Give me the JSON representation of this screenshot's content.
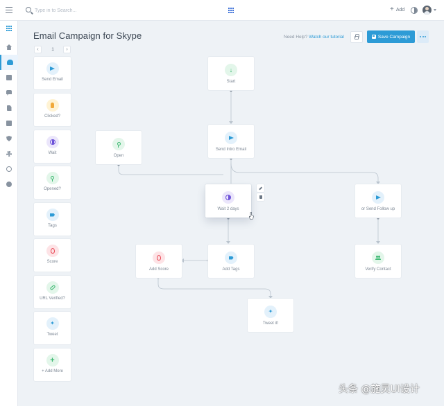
{
  "topbar": {
    "search_placeholder": "Type in to Search...",
    "apps_icon": "apps-grid-icon",
    "add_label": "Add"
  },
  "sidebar": {
    "items": [
      {
        "icon": "apps-icon"
      },
      {
        "icon": "home-icon"
      },
      {
        "icon": "users-icon",
        "active": true
      },
      {
        "icon": "building-icon"
      },
      {
        "icon": "chat-icon"
      },
      {
        "icon": "document-icon"
      },
      {
        "icon": "calendar-icon"
      },
      {
        "icon": "shield-icon"
      },
      {
        "icon": "gear-icon"
      },
      {
        "icon": "clock-icon"
      },
      {
        "icon": "globe-icon"
      }
    ]
  },
  "header": {
    "title": "Email Campaign for Skype",
    "help_prefix": "Need Help?",
    "help_link": "Watch our tutorial",
    "save_label": "Save Campaign"
  },
  "pager": {
    "page": "1",
    "prev": "‹",
    "next": "›"
  },
  "tools": [
    {
      "label": "Send Email",
      "icon": "send-icon",
      "color": "blue"
    },
    {
      "label": "Clicked?",
      "icon": "hand-pointer-icon",
      "color": "yellow"
    },
    {
      "label": "Wait",
      "icon": "clock-icon",
      "color": "purple"
    },
    {
      "label": "Opened?",
      "icon": "location-pin-icon",
      "color": "green"
    },
    {
      "label": "Tags",
      "icon": "tag-icon",
      "color": "blue"
    },
    {
      "label": "Score",
      "icon": "flame-icon",
      "color": "red"
    },
    {
      "label": "URL Verified?",
      "icon": "link-icon",
      "color": "green"
    },
    {
      "label": "Tweet",
      "icon": "twitter-icon",
      "color": "blue"
    },
    {
      "label": "+ Add More",
      "icon": "plus-icon",
      "color": "green"
    }
  ],
  "flow": {
    "nodes": {
      "start": {
        "label": "Start",
        "icon": "arrow-down-icon"
      },
      "send_intro": {
        "label": "Send Intro Email",
        "icon": "send-icon"
      },
      "open": {
        "label": "Open",
        "icon": "location-pin-icon"
      },
      "wait": {
        "label": "Wait 2 days",
        "icon": "clock-icon"
      },
      "follow_up": {
        "label": "or Send Follow up",
        "icon": "send-icon"
      },
      "add_score": {
        "label": "Add Score",
        "icon": "flame-icon"
      },
      "add_tags": {
        "label": "Add Tags",
        "icon": "tag-icon"
      },
      "verify": {
        "label": "Verify Contact",
        "icon": "people-icon"
      },
      "tweet": {
        "label": "Tweet it!",
        "icon": "twitter-icon"
      }
    }
  },
  "colors": {
    "accent": "#2d9bd6",
    "background": "#eef2f6",
    "connector": "#b9c3cd"
  },
  "watermark": "头条 @施灵UI设计"
}
